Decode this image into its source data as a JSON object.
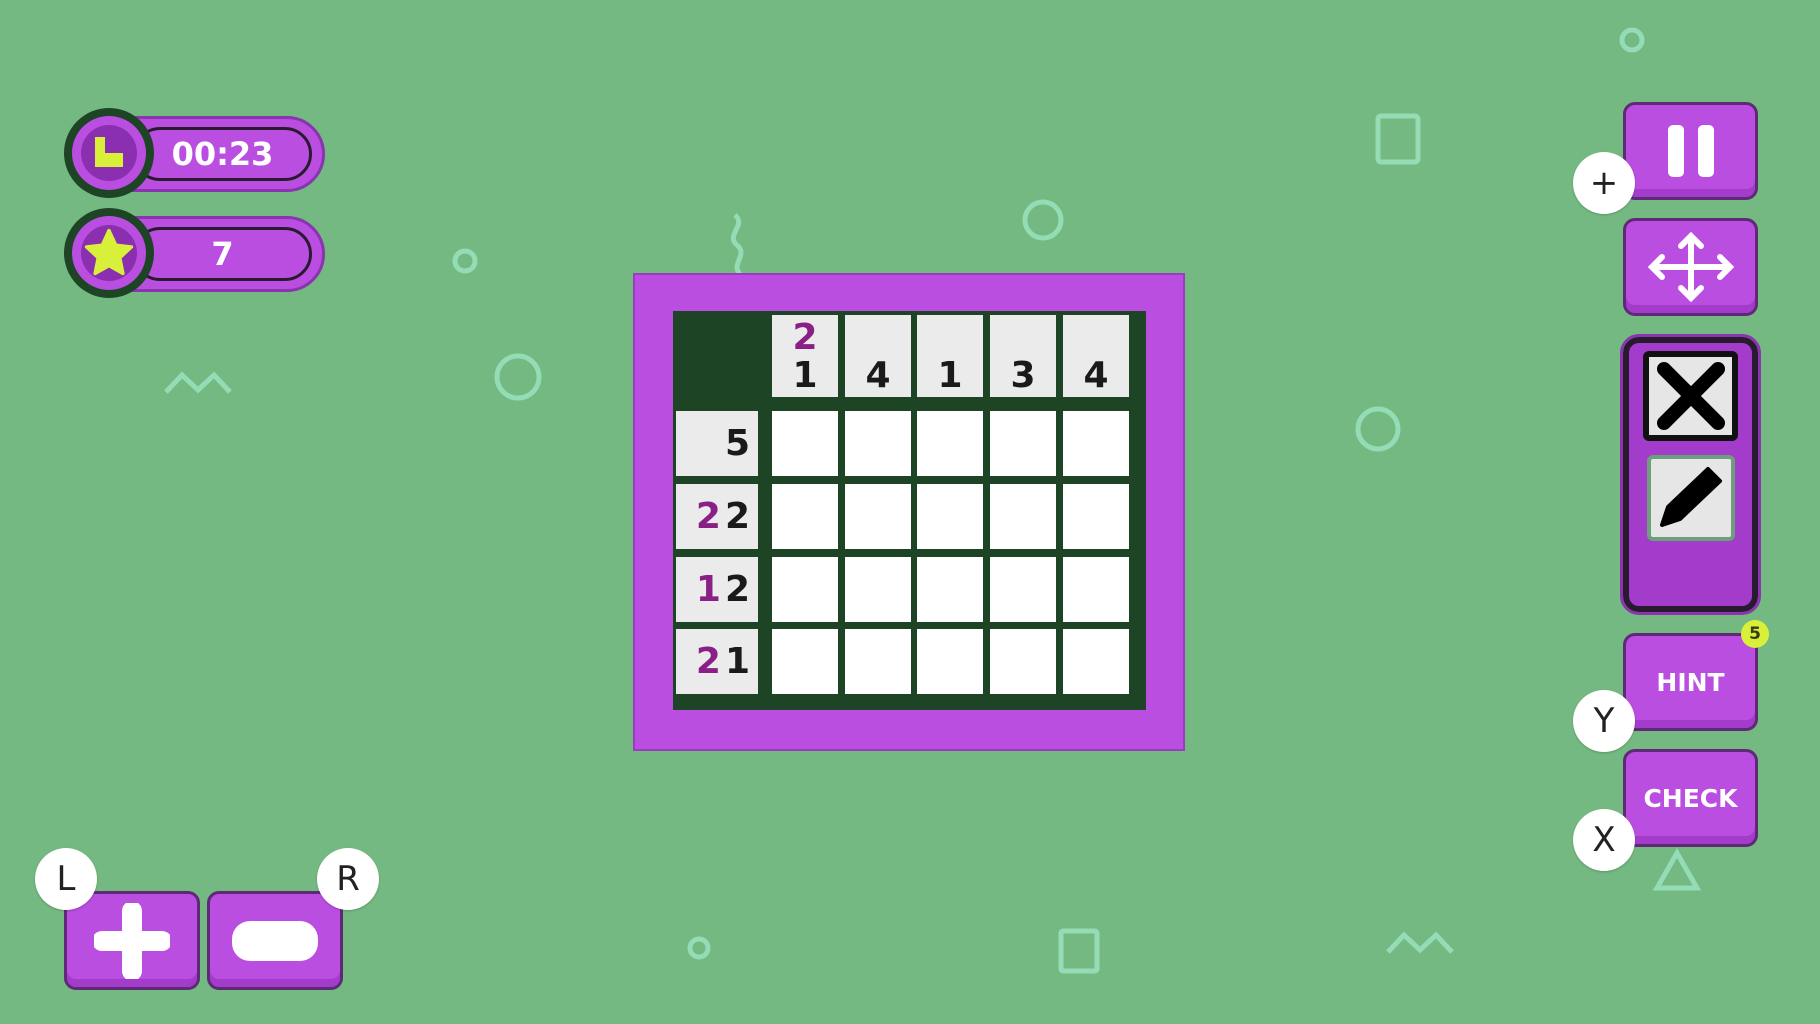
{
  "hud": {
    "timer": "00:23",
    "stars": "7",
    "timer_icon": "clock-icon",
    "stars_icon": "star-icon"
  },
  "puzzle": {
    "column_clues": [
      [
        "2",
        "1"
      ],
      [
        "4"
      ],
      [
        "1"
      ],
      [
        "3"
      ],
      [
        "4"
      ]
    ],
    "row_clues": [
      [
        "5"
      ],
      [
        "2",
        "2"
      ],
      [
        "1",
        "2"
      ],
      [
        "2",
        "1"
      ]
    ],
    "rows": 4,
    "cols": 5
  },
  "controls": {
    "pause_key": "+",
    "hint_label": "HINT",
    "hint_count": "5",
    "hint_key": "Y",
    "check_label": "CHECK",
    "check_key": "X",
    "zoom_in_key": "L",
    "zoom_out_key": "R",
    "active_tool": "cross"
  },
  "colors": {
    "background": "#74b981",
    "purple": "#b94ee0",
    "grid": "#1d4424",
    "clue_highlight": "#8a1f86",
    "accent": "#d9f03a"
  }
}
